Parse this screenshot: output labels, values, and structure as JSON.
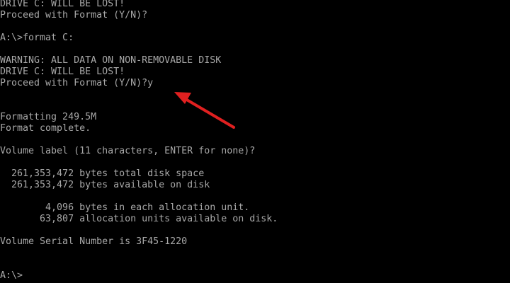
{
  "terminal": {
    "text_color": "#a8a8a8",
    "background_color": "#000000",
    "lines": [
      "DRIVE C: WILL BE LOST!",
      "Proceed with Format (Y/N)?",
      "",
      "A:\\>format C:",
      "",
      "WARNING: ALL DATA ON NON-REMOVABLE DISK",
      "DRIVE C: WILL BE LOST!",
      "Proceed with Format (Y/N)?y",
      "",
      "",
      "Formatting 249.5M",
      "Format complete.",
      "",
      "Volume label (11 characters, ENTER for none)?",
      "",
      "  261,353,472 bytes total disk space",
      "  261,353,472 bytes available on disk",
      "",
      "        4,096 bytes in each allocation unit.",
      "       63,807 allocation units available on disk.",
      "",
      "Volume Serial Number is 3F45-1220",
      "",
      "",
      "A:\\>"
    ]
  },
  "annotation": {
    "icon": "red-arrow-icon",
    "color": "#e02020"
  }
}
